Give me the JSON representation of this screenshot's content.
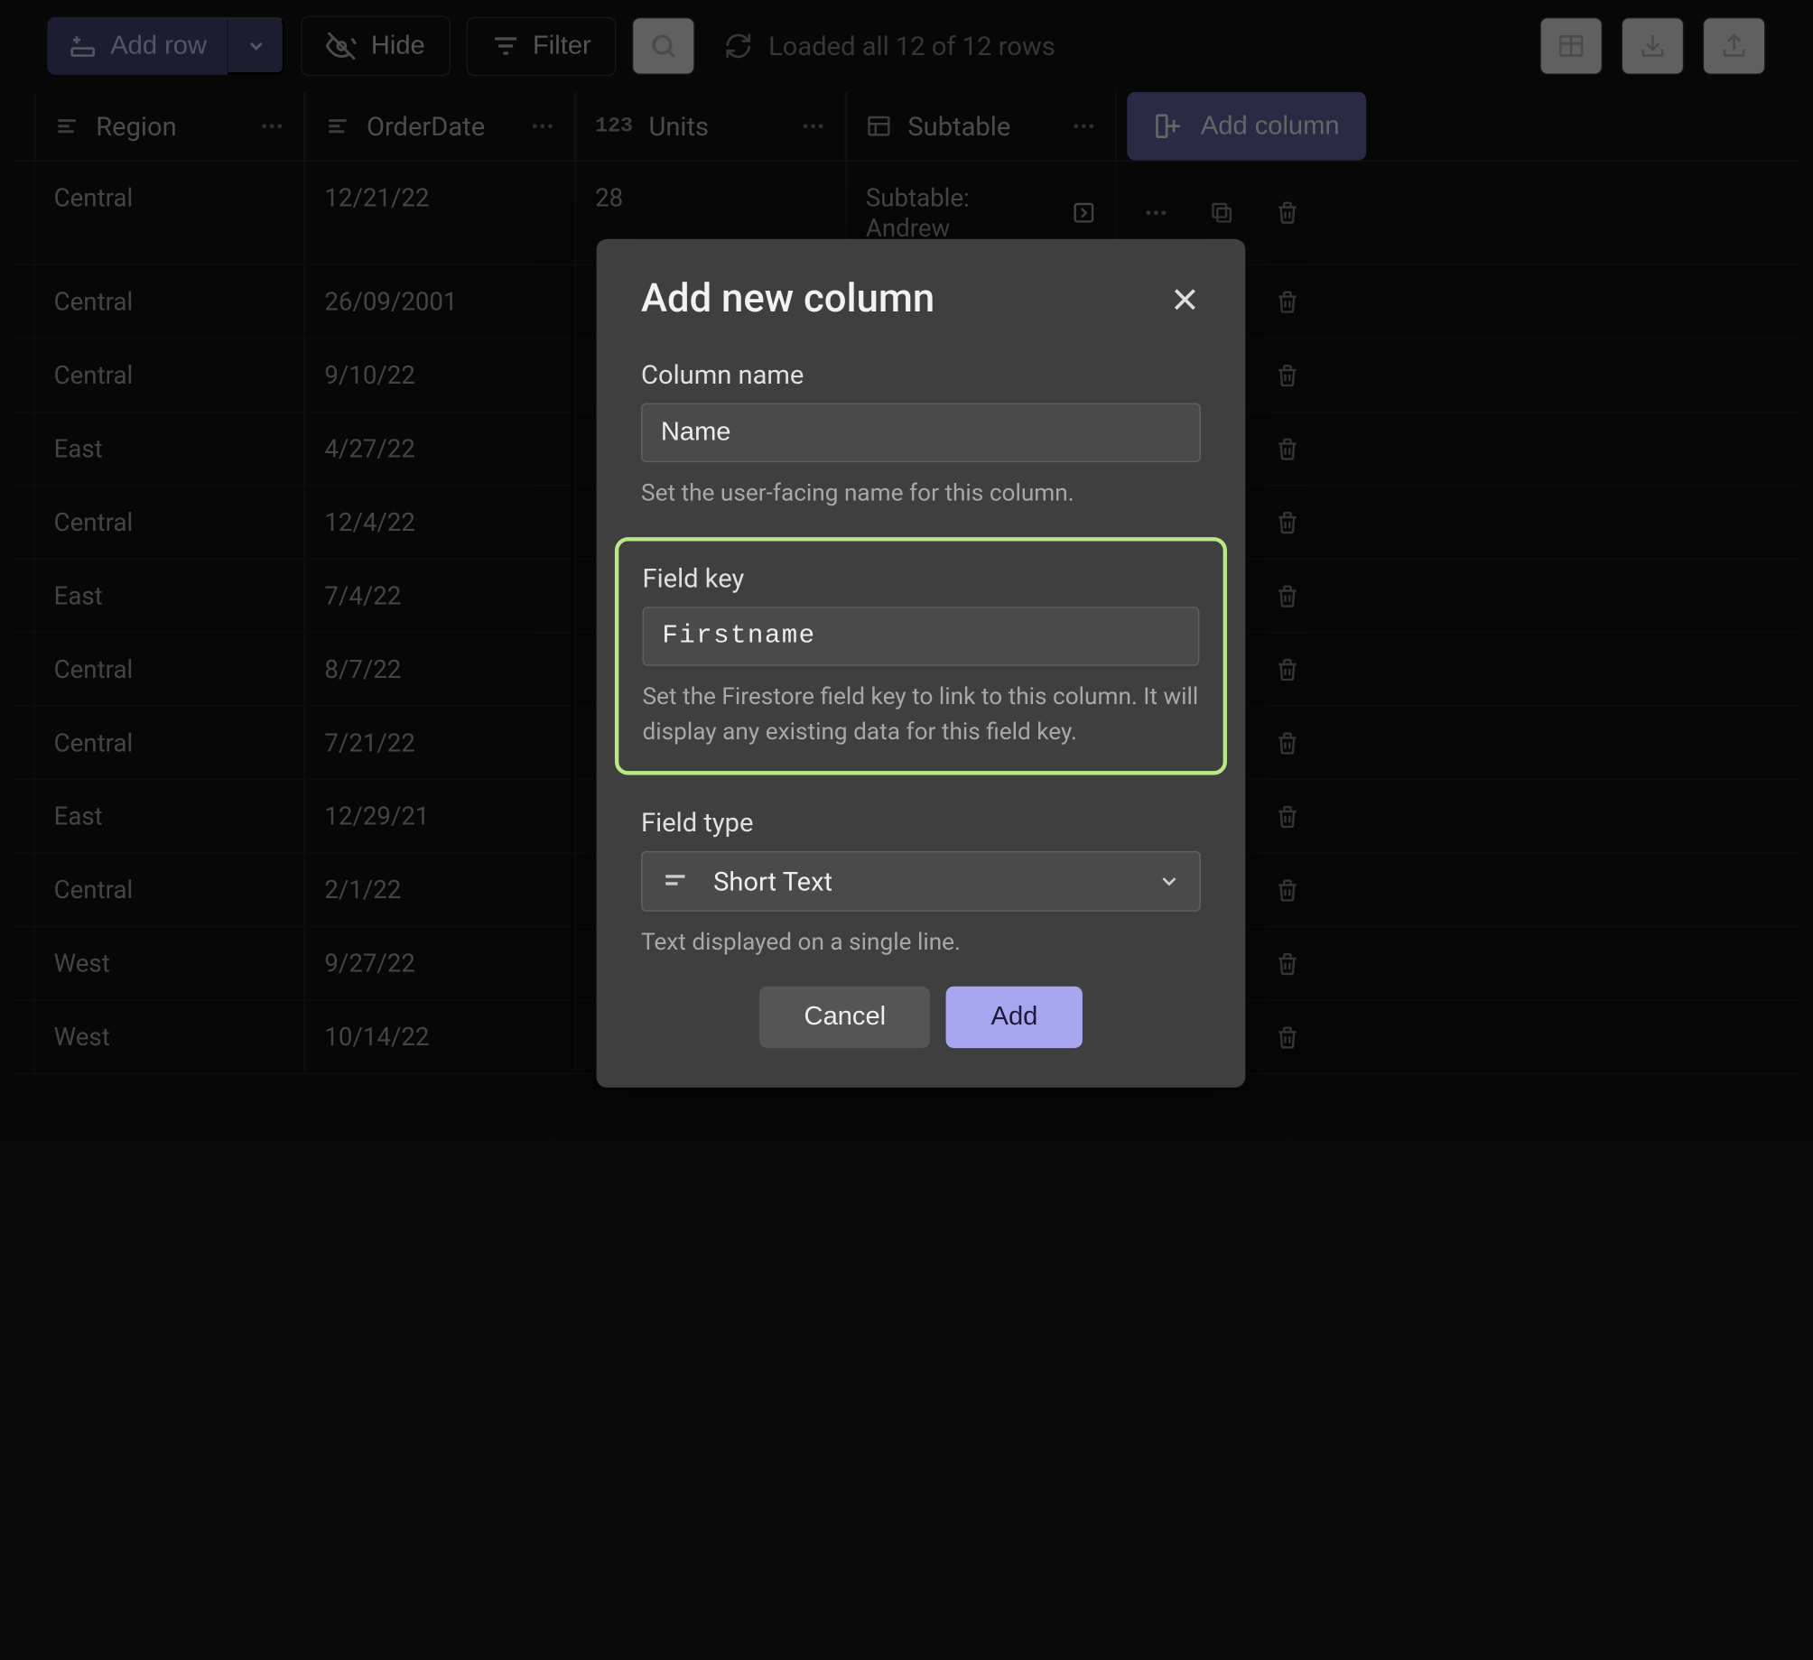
{
  "toolbar": {
    "add_row": "Add row",
    "hide": "Hide",
    "filter": "Filter",
    "status": "Loaded all 12 of 12 rows"
  },
  "columns": {
    "region": "Region",
    "order_date": "OrderDate",
    "units": "Units",
    "subtable": "Subtable",
    "add_column": "Add column"
  },
  "rows": [
    {
      "region": "Central",
      "date": "12/21/22",
      "units": "28",
      "subtable": "Subtable: Andrew"
    },
    {
      "region": "Central",
      "date": "26/09/2001"
    },
    {
      "region": "Central",
      "date": "9/10/22"
    },
    {
      "region": "East",
      "date": "4/27/22"
    },
    {
      "region": "Central",
      "date": "12/4/22"
    },
    {
      "region": "East",
      "date": "7/4/22"
    },
    {
      "region": "Central",
      "date": "8/7/22"
    },
    {
      "region": "Central",
      "date": "7/21/22"
    },
    {
      "region": "East",
      "date": "12/29/21"
    },
    {
      "region": "Central",
      "date": "2/1/22"
    },
    {
      "region": "West",
      "date": "9/27/22"
    },
    {
      "region": "West",
      "date": "10/14/22"
    }
  ],
  "modal": {
    "title": "Add new column",
    "column_name_label": "Column name",
    "column_name_value": "Name",
    "column_name_hint": "Set the user-facing name for this column.",
    "field_key_label": "Field key",
    "field_key_value": "Firstname",
    "field_key_hint": "Set the Firestore field key to link to this column. It will display any existing data for this field key.",
    "field_type_label": "Field type",
    "field_type_value": "Short Text",
    "field_type_hint": "Text displayed on a single line.",
    "cancel": "Cancel",
    "add": "Add"
  }
}
